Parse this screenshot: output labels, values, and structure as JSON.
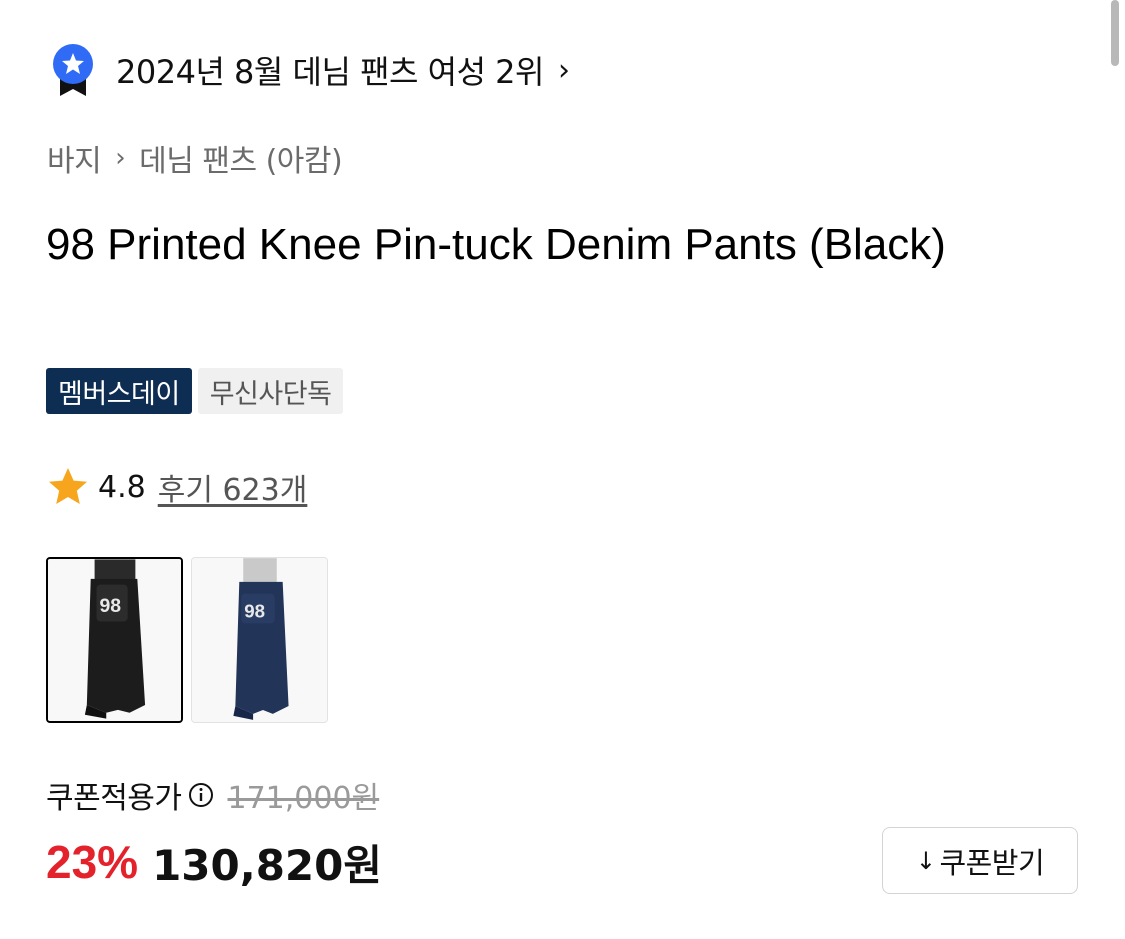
{
  "ranking": {
    "text": "2024년 8월 데님 팬츠 여성 2위",
    "chevron": "›",
    "icon": "ranking-badge-icon",
    "icon_color": "#2f6bf5"
  },
  "breadcrumb": {
    "items": [
      "바지",
      "데님 팬츠 (아캄)"
    ],
    "separator": "›"
  },
  "product": {
    "title": "98 Printed Knee Pin-tuck Denim Pants (Black)"
  },
  "badges": [
    {
      "label": "멤버스데이",
      "style": "dark",
      "color": "#0e2d52"
    },
    {
      "label": "무신사단독",
      "style": "light",
      "color": "#f0f0f0"
    }
  ],
  "rating": {
    "score": "4.8",
    "reviews_label": "후기 623개",
    "star_color": "#f7a51d"
  },
  "thumbnails": [
    {
      "label": "98",
      "color_name": "Black",
      "selected": true
    },
    {
      "label": "98",
      "color_name": "Navy",
      "selected": false
    }
  ],
  "price": {
    "label": "쿠폰적용가",
    "original": "171,000원",
    "discount": "23%",
    "sale": "130,820원",
    "discount_color": "#e3222b"
  },
  "coupon_button": {
    "icon": "↓",
    "label": "쿠폰받기"
  }
}
